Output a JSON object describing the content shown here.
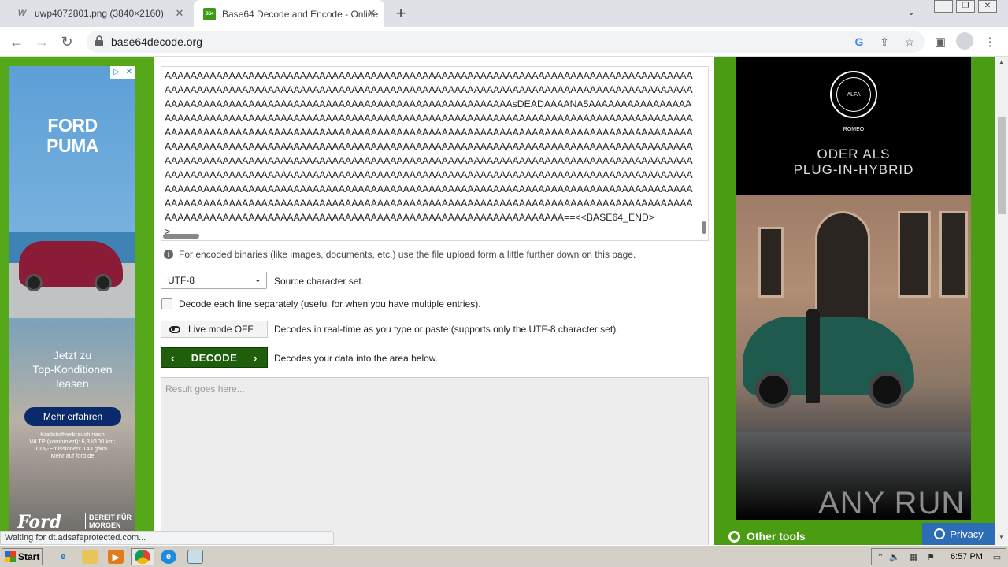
{
  "browser": {
    "tabs": [
      {
        "title": "uwp4072801.png (3840×2160)",
        "favicon": "W"
      },
      {
        "title": "Base64 Decode and Encode - Online",
        "favicon": "B64"
      }
    ],
    "url": "base64decode.org",
    "status": "Waiting for dt.adsafeprotected.com..."
  },
  "encoded": {
    "lines": [
      "AAAAAAAAAAAAAAAAAAAAAAAAAAAAAAAAAAAAAAAAAAAAAAAAAAAAAAAAAAAAAAAAAAAAAAAAAAAAAAAAAA",
      "AAAAAAAAAAAAAAAAAAAAAAAAAAAAAAAAAAAAAAAAAAAAAAAAAAAAAAAAAAAAAAAAAAAAAAAAAAAAAAAAAA",
      "AAAAAAAAAAAAAAAAAAAAAAAAAAAAAAAAAAAAAAAAAAAAAAAAAAAAAAsDEADAAAANA5AAAAAAAAAAAAAAAA",
      "AAAAAAAAAAAAAAAAAAAAAAAAAAAAAAAAAAAAAAAAAAAAAAAAAAAAAAAAAAAAAAAAAAAAAAAAAAAAAAAAAA",
      "AAAAAAAAAAAAAAAAAAAAAAAAAAAAAAAAAAAAAAAAAAAAAAAAAAAAAAAAAAAAAAAAAAAAAAAAAAAAAAAAAA",
      "AAAAAAAAAAAAAAAAAAAAAAAAAAAAAAAAAAAAAAAAAAAAAAAAAAAAAAAAAAAAAAAAAAAAAAAAAAAAAAAAAA",
      "AAAAAAAAAAAAAAAAAAAAAAAAAAAAAAAAAAAAAAAAAAAAAAAAAAAAAAAAAAAAAAAAAAAAAAAAAAAAAAAAAA",
      "AAAAAAAAAAAAAAAAAAAAAAAAAAAAAAAAAAAAAAAAAAAAAAAAAAAAAAAAAAAAAAAAAAAAAAAAAAAAAAAAAA",
      "AAAAAAAAAAAAAAAAAAAAAAAAAAAAAAAAAAAAAAAAAAAAAAAAAAAAAAAAAAAAAAAAAAAAAAAAAAAAAAAAAA",
      "AAAAAAAAAAAAAAAAAAAAAAAAAAAAAAAAAAAAAAAAAAAAAAAAAAAAAAAAAAAAAAAAAAAAAAAAAAAAAAAAAA",
      "AAAAAAAAAAAAAAAAAAAAAAAAAAAAAAAAAAAAAAAAAAAAAAAAAAAAAAAAAAAAAA==<<BASE64_END>",
      ">"
    ]
  },
  "form": {
    "info": "For encoded binaries (like images, documents, etc.) use the file upload form a little further down on this page.",
    "charset_value": "UTF-8",
    "charset_label": "Source character set.",
    "each_line_label": "Decode each line separately (useful for when you have multiple entries).",
    "live_mode_label": "Live mode OFF",
    "live_mode_desc": "Decodes in real-time as you type or paste (supports only the UTF-8 character set).",
    "decode_label": "DECODE",
    "decode_desc": "Decodes your data into the area below.",
    "result_placeholder": "Result goes here..."
  },
  "ads": {
    "left": {
      "title_line1": "FORD",
      "title_line2": "PUMA",
      "sub_line1": "Jetzt zu",
      "sub_line2": "Top-Konditionen",
      "sub_line3": "leasen",
      "cta": "Mehr erfahren",
      "fine1": "Kraftstoffverbrauch nach",
      "fine2": "WLTP (kombiniert): 6,3 l/100 km;",
      "fine3": "CO₂-Emissionen: 143 g/km.",
      "fine4": "Mehr auf ford.de",
      "logo": "Ford",
      "slogan1": "BEREIT FÜR",
      "slogan2": "MORGEN"
    },
    "right": {
      "brand": "ALFA ROMEO",
      "text_line1": "ODER ALS",
      "text_line2": "PLUG-IN-HYBRID",
      "watermark": "ANY RUN"
    }
  },
  "footer": {
    "other_tools": "Other tools",
    "privacy": "Privacy"
  },
  "taskbar": {
    "start": "Start",
    "time": "6:57 PM"
  },
  "colors": {
    "page_green": "#4a9c12",
    "decode_button": "#1f5f0b",
    "privacy_blue": "#2c6db6"
  }
}
